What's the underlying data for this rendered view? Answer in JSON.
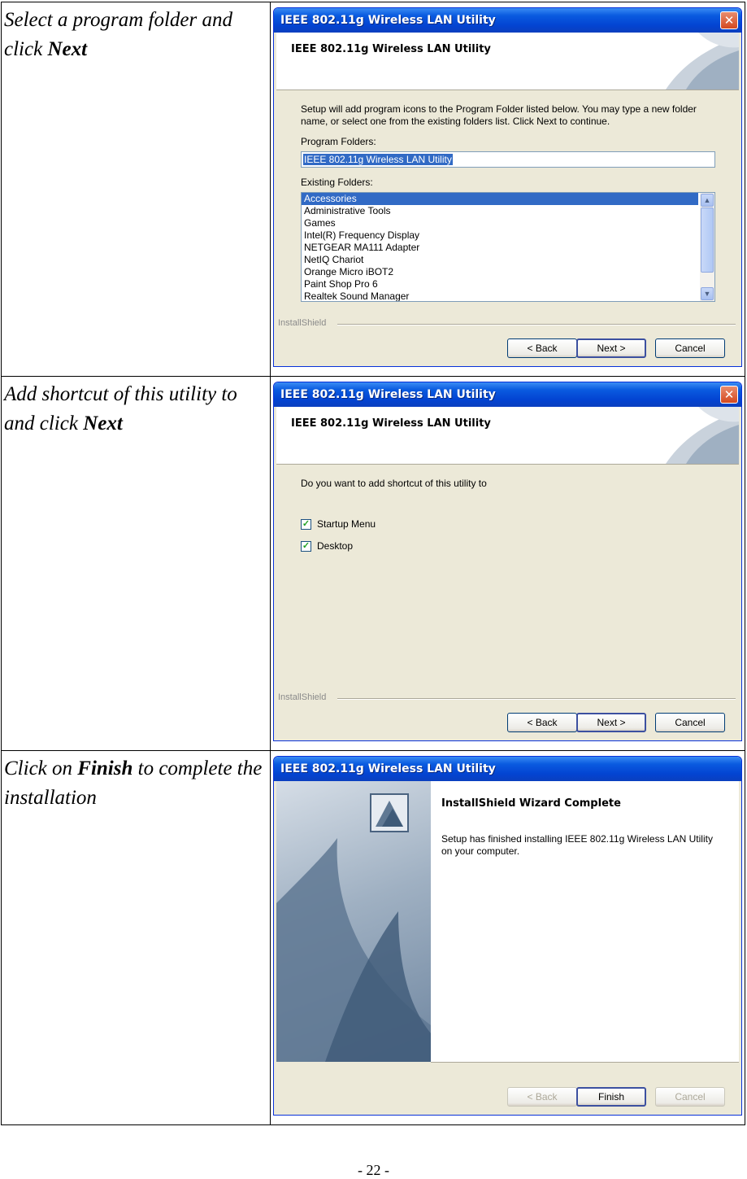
{
  "rows": [
    {
      "desc_prefix": "Select a program folder and click ",
      "desc_bold": "Next",
      "desc_suffix": "",
      "dialog": {
        "title": "IEEE 802.11g Wireless LAN Utility",
        "header": "IEEE 802.11g Wireless LAN Utility",
        "instruction": "Setup will add program icons to the Program Folder listed below.  You may type a new folder name, or select one from the existing folders list.  Click Next to continue.",
        "program_folders_label": "Program Folders:",
        "program_folder_value": "IEEE 802.11g Wireless LAN Utility",
        "existing_folders_label": "Existing Folders:",
        "existing_folders": [
          "Accessories",
          "Administrative Tools",
          "Games",
          "Intel(R) Frequency Display",
          "NETGEAR MA111 Adapter",
          "NetIQ Chariot",
          "Orange Micro iBOT2",
          "Paint Shop Pro 6",
          "Realtek Sound Manager"
        ],
        "selected_folder": "Accessories",
        "installshield": "InstallShield",
        "back": "< Back",
        "next": "Next >",
        "cancel": "Cancel"
      }
    },
    {
      "desc_prefix": "Add shortcut of this utility to and click ",
      "desc_bold": "Next",
      "desc_suffix": "",
      "dialog": {
        "title": "IEEE 802.11g Wireless LAN Utility",
        "header": "IEEE 802.11g Wireless LAN Utility",
        "question": "Do you want to add shortcut of this utility to",
        "options": [
          {
            "label": "Startup Menu",
            "checked": true
          },
          {
            "label": "Desktop",
            "checked": true
          }
        ],
        "installshield": "InstallShield",
        "back": "< Back",
        "next": "Next >",
        "cancel": "Cancel"
      }
    },
    {
      "desc_prefix": "Click on ",
      "desc_bold": "Finish",
      "desc_suffix": " to complete the installation",
      "dialog": {
        "title": "IEEE 802.11g Wireless LAN Utility",
        "heading": "InstallShield Wizard Complete",
        "message": "Setup has finished installing IEEE 802.11g Wireless LAN Utility on your computer.",
        "back": "< Back",
        "finish": "Finish",
        "cancel": "Cancel"
      }
    }
  ],
  "page_number": "- 22 -",
  "colors": {
    "title_bar": "#0a5be0",
    "selection": "#316ac5",
    "dialog_bg": "#ece9d8"
  }
}
